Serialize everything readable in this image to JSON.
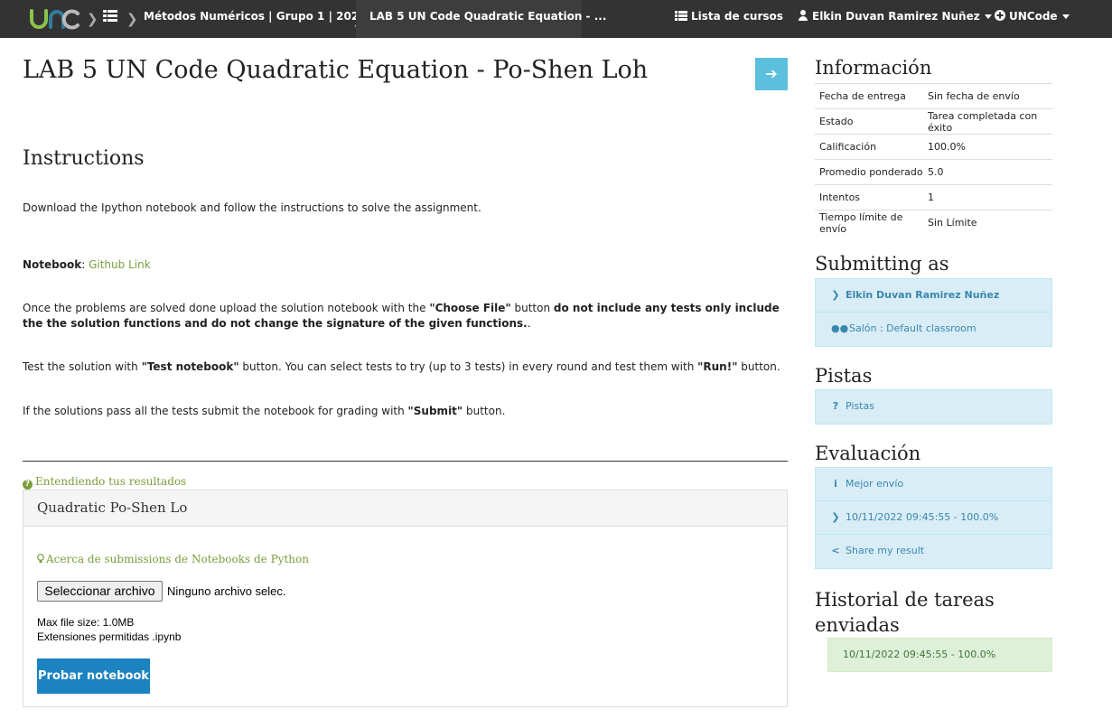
{
  "navbar": {
    "logo_text": "UNC",
    "breadcrumb_course": "Métodos Numéricos | Grupo 1 | 2022...",
    "breadcrumb_task": "LAB 5 UN Code Quadratic Equation - ...",
    "course_list": "Lista de cursos",
    "user_name": "Elkin Duvan Ramirez Nuñez",
    "app_menu": "UNCode"
  },
  "main": {
    "title": "LAB 5 UN Code Quadratic Equation - Po-Shen Loh",
    "instructions_heading": "Instructions",
    "p1": "Download the Ipython notebook and follow the instructions to solve the assignment.",
    "notebook_label": "Notebook",
    "notebook_link": "Github Link",
    "p3_a": "Once the problems are solved done upload the solution notebook with the ",
    "p3_b": "\"Choose File\"",
    "p3_c": " button ",
    "p3_d": "do not include any tests only include the the solution functions and do not change the signature of the given functions.",
    "p3_e": ".",
    "p4_a": "Test the solution with ",
    "p4_b": "\"Test notebook\"",
    "p4_c": " button. You can select tests to try (up to 3 tests) in every round and test them with ",
    "p4_d": "\"Run!\"",
    "p4_e": " button.",
    "p5_a": "If the solutions pass all the tests submit the notebook for grading with ",
    "p5_b": "\"Submit\"",
    "p5_c": " button.",
    "understanding_link": "Entendiendo tus resultados",
    "panel_title": "Quadratic Po-Shen Lo",
    "about_link": "Acerca de submissions de Notebooks de Python",
    "file_button": "Seleccionar archivo",
    "file_status": "Ninguno archivo selec.",
    "max_size": "Max file size: 1.0MB",
    "extensions": "Extensiones permitidas .ipynb",
    "test_button": "Probar notebook"
  },
  "sidebar": {
    "info_heading": "Información",
    "info_rows": [
      {
        "key": "Fecha de entrega",
        "value": "Sin fecha de envío"
      },
      {
        "key": "Estado",
        "value": "Tarea completada con éxito"
      },
      {
        "key": "Calificación",
        "value": "100.0%"
      },
      {
        "key": "Promedio ponderado",
        "value": "5.0"
      },
      {
        "key": "Intentos",
        "value": "1"
      },
      {
        "key": "Tiempo límite de envío",
        "value": "Sin Límite"
      }
    ],
    "submitting_heading": "Submitting as",
    "submitting_user": "Elkin Duvan Ramirez Nuñez",
    "classroom": "Salón : Default classroom",
    "hints_heading": "Pistas",
    "hints_link": "Pistas",
    "eval_heading": "Evaluación",
    "best_submission": "Mejor envío",
    "best_entry": "10/11/2022 09:45:55 - 100.0%",
    "share": "Share my result",
    "history_heading": "Historial de tareas enviadas",
    "history_entry": "10/11/2022 09:45:55 - 100.0%"
  },
  "colors": {
    "navbar": "#333333",
    "accent_blue": "#5bc0de",
    "link_green": "#7a9e3c",
    "info_box": "#d9edf7",
    "success_box": "#dff0d8",
    "primary_button": "#1a83c0"
  },
  "icons": [
    "unc-logo",
    "home-grid-icon",
    "list-icon",
    "user-icon",
    "plus-circle-icon",
    "arrow-right-icon",
    "question-circle-icon",
    "lightbulb-icon",
    "chevron-right-icon",
    "users-icon",
    "info-icon",
    "share-icon"
  ]
}
